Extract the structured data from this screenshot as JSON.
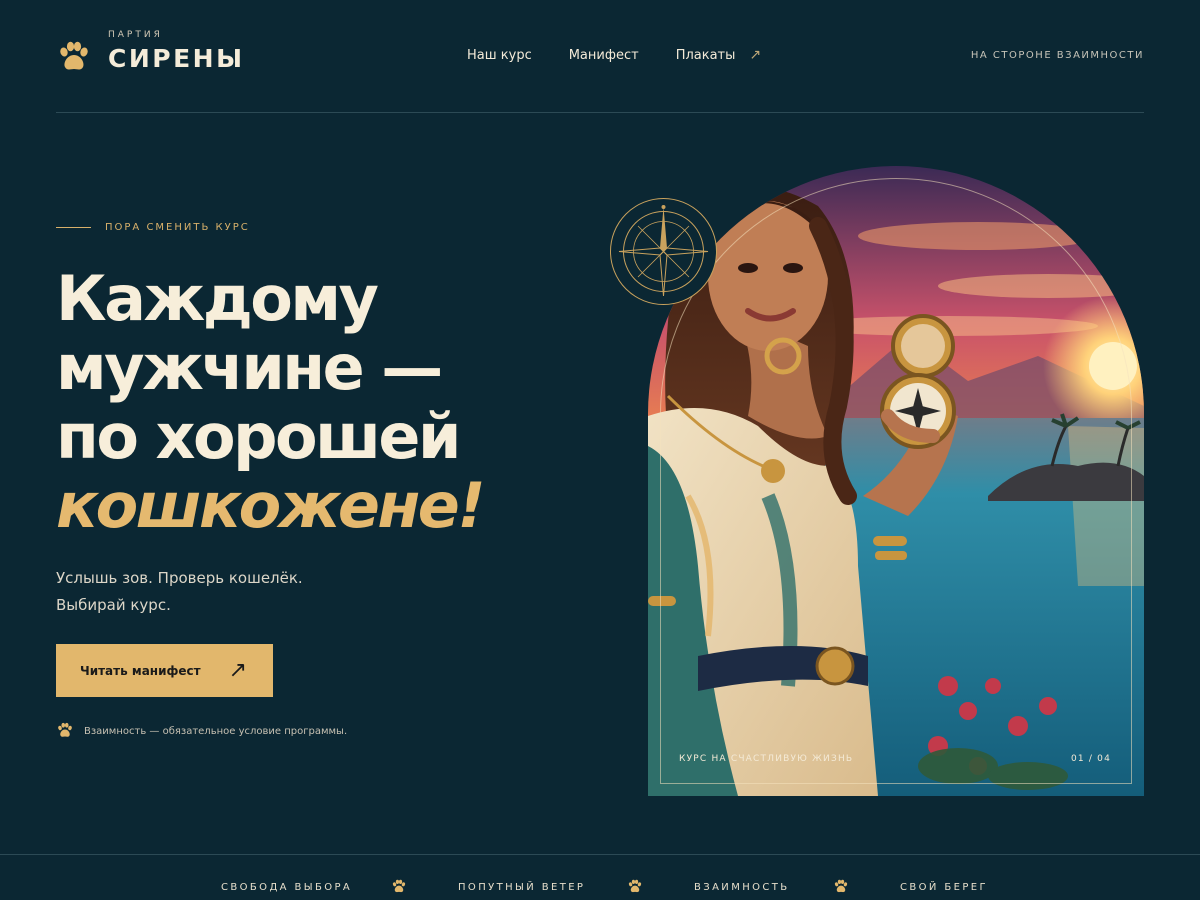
{
  "header": {
    "logo_small": "ПАРТИЯ",
    "logo_title": "СИРЕНЫ",
    "nav": [
      "Наш курс",
      "Манифест",
      "Плакаты"
    ],
    "nav_external_arrow": "↗",
    "right_text": "НА СТОРОНЕ ВЗАИМНОСТИ"
  },
  "hero": {
    "eyebrow": "ПОРА СМЕНИТЬ КУРС",
    "headline_lines": [
      "Каждому",
      "мужчине —",
      "по хорошей"
    ],
    "headline_accent": "кошкожене!",
    "sub_lines": [
      "Услышь зов. Проверь кошелёк.",
      "Выбирай курс."
    ],
    "cta_label": "Читать манифест",
    "cta_arrow": "↗",
    "note": "Взаимность — обязательное условие программы."
  },
  "image": {
    "caption": "КУРС НА СЧАСТЛИВУЮ ЖИЗНЬ",
    "pager": "01 / 04"
  },
  "strip": [
    "СВОБОДА ВЫБОРА",
    "ПОПУТНЫЙ ВЕТЕР",
    "ВЗАИМНОСТЬ",
    "СВОЙ БЕРЕГ"
  ],
  "colors": {
    "background": "#0b2733",
    "accent_gold": "#e2b76c",
    "text_light": "#f3ead8"
  },
  "icons": [
    "paw-icon",
    "arrow-up-right-icon",
    "compass-icon"
  ]
}
